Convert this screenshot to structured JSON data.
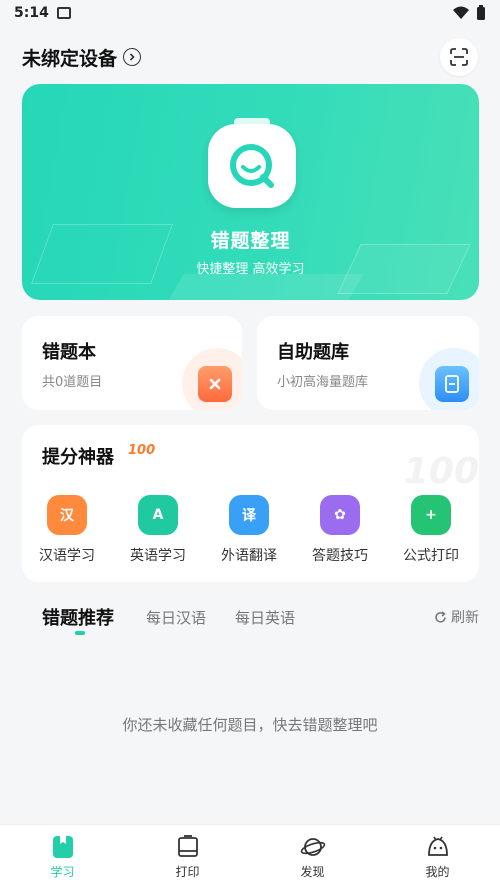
{
  "status": {
    "time": "5:14"
  },
  "header": {
    "title": "未绑定设备"
  },
  "banner": {
    "title": "错题整理",
    "subtitle": "快捷整理 高效学习"
  },
  "cards": {
    "wrong": {
      "title": "错题本",
      "subtitle": "共0道题目"
    },
    "bank": {
      "title": "自助题库",
      "subtitle": "小初高海量题库"
    }
  },
  "tools": {
    "title": "提分神器",
    "badge": "100",
    "items": [
      {
        "label": "汉语学习",
        "glyph": "汉",
        "color": "#ff8a3d",
        "icon": "chinese-icon"
      },
      {
        "label": "英语学习",
        "glyph": "A",
        "color": "#20c9a0",
        "icon": "english-icon"
      },
      {
        "label": "外语翻译",
        "glyph": "译",
        "color": "#3aa0f5",
        "icon": "translate-icon"
      },
      {
        "label": "答题技巧",
        "glyph": "✿",
        "color": "#9b6cf0",
        "icon": "tips-icon"
      },
      {
        "label": "公式打印",
        "glyph": "+",
        "color": "#25c474",
        "icon": "formula-icon"
      }
    ]
  },
  "tabs": {
    "items": [
      "错题推荐",
      "每日汉语",
      "每日英语"
    ],
    "refresh": "刷新"
  },
  "empty_text": "你还未收藏任何题目，快去错题整理吧",
  "nav": [
    {
      "label": "学习",
      "icon": "study-icon",
      "active": true
    },
    {
      "label": "打印",
      "icon": "printer-icon",
      "active": false
    },
    {
      "label": "发现",
      "icon": "planet-icon",
      "active": false
    },
    {
      "label": "我的",
      "icon": "profile-icon",
      "active": false
    }
  ],
  "colors": {
    "accent": "#22cfa9",
    "banner": "#2edab8"
  }
}
